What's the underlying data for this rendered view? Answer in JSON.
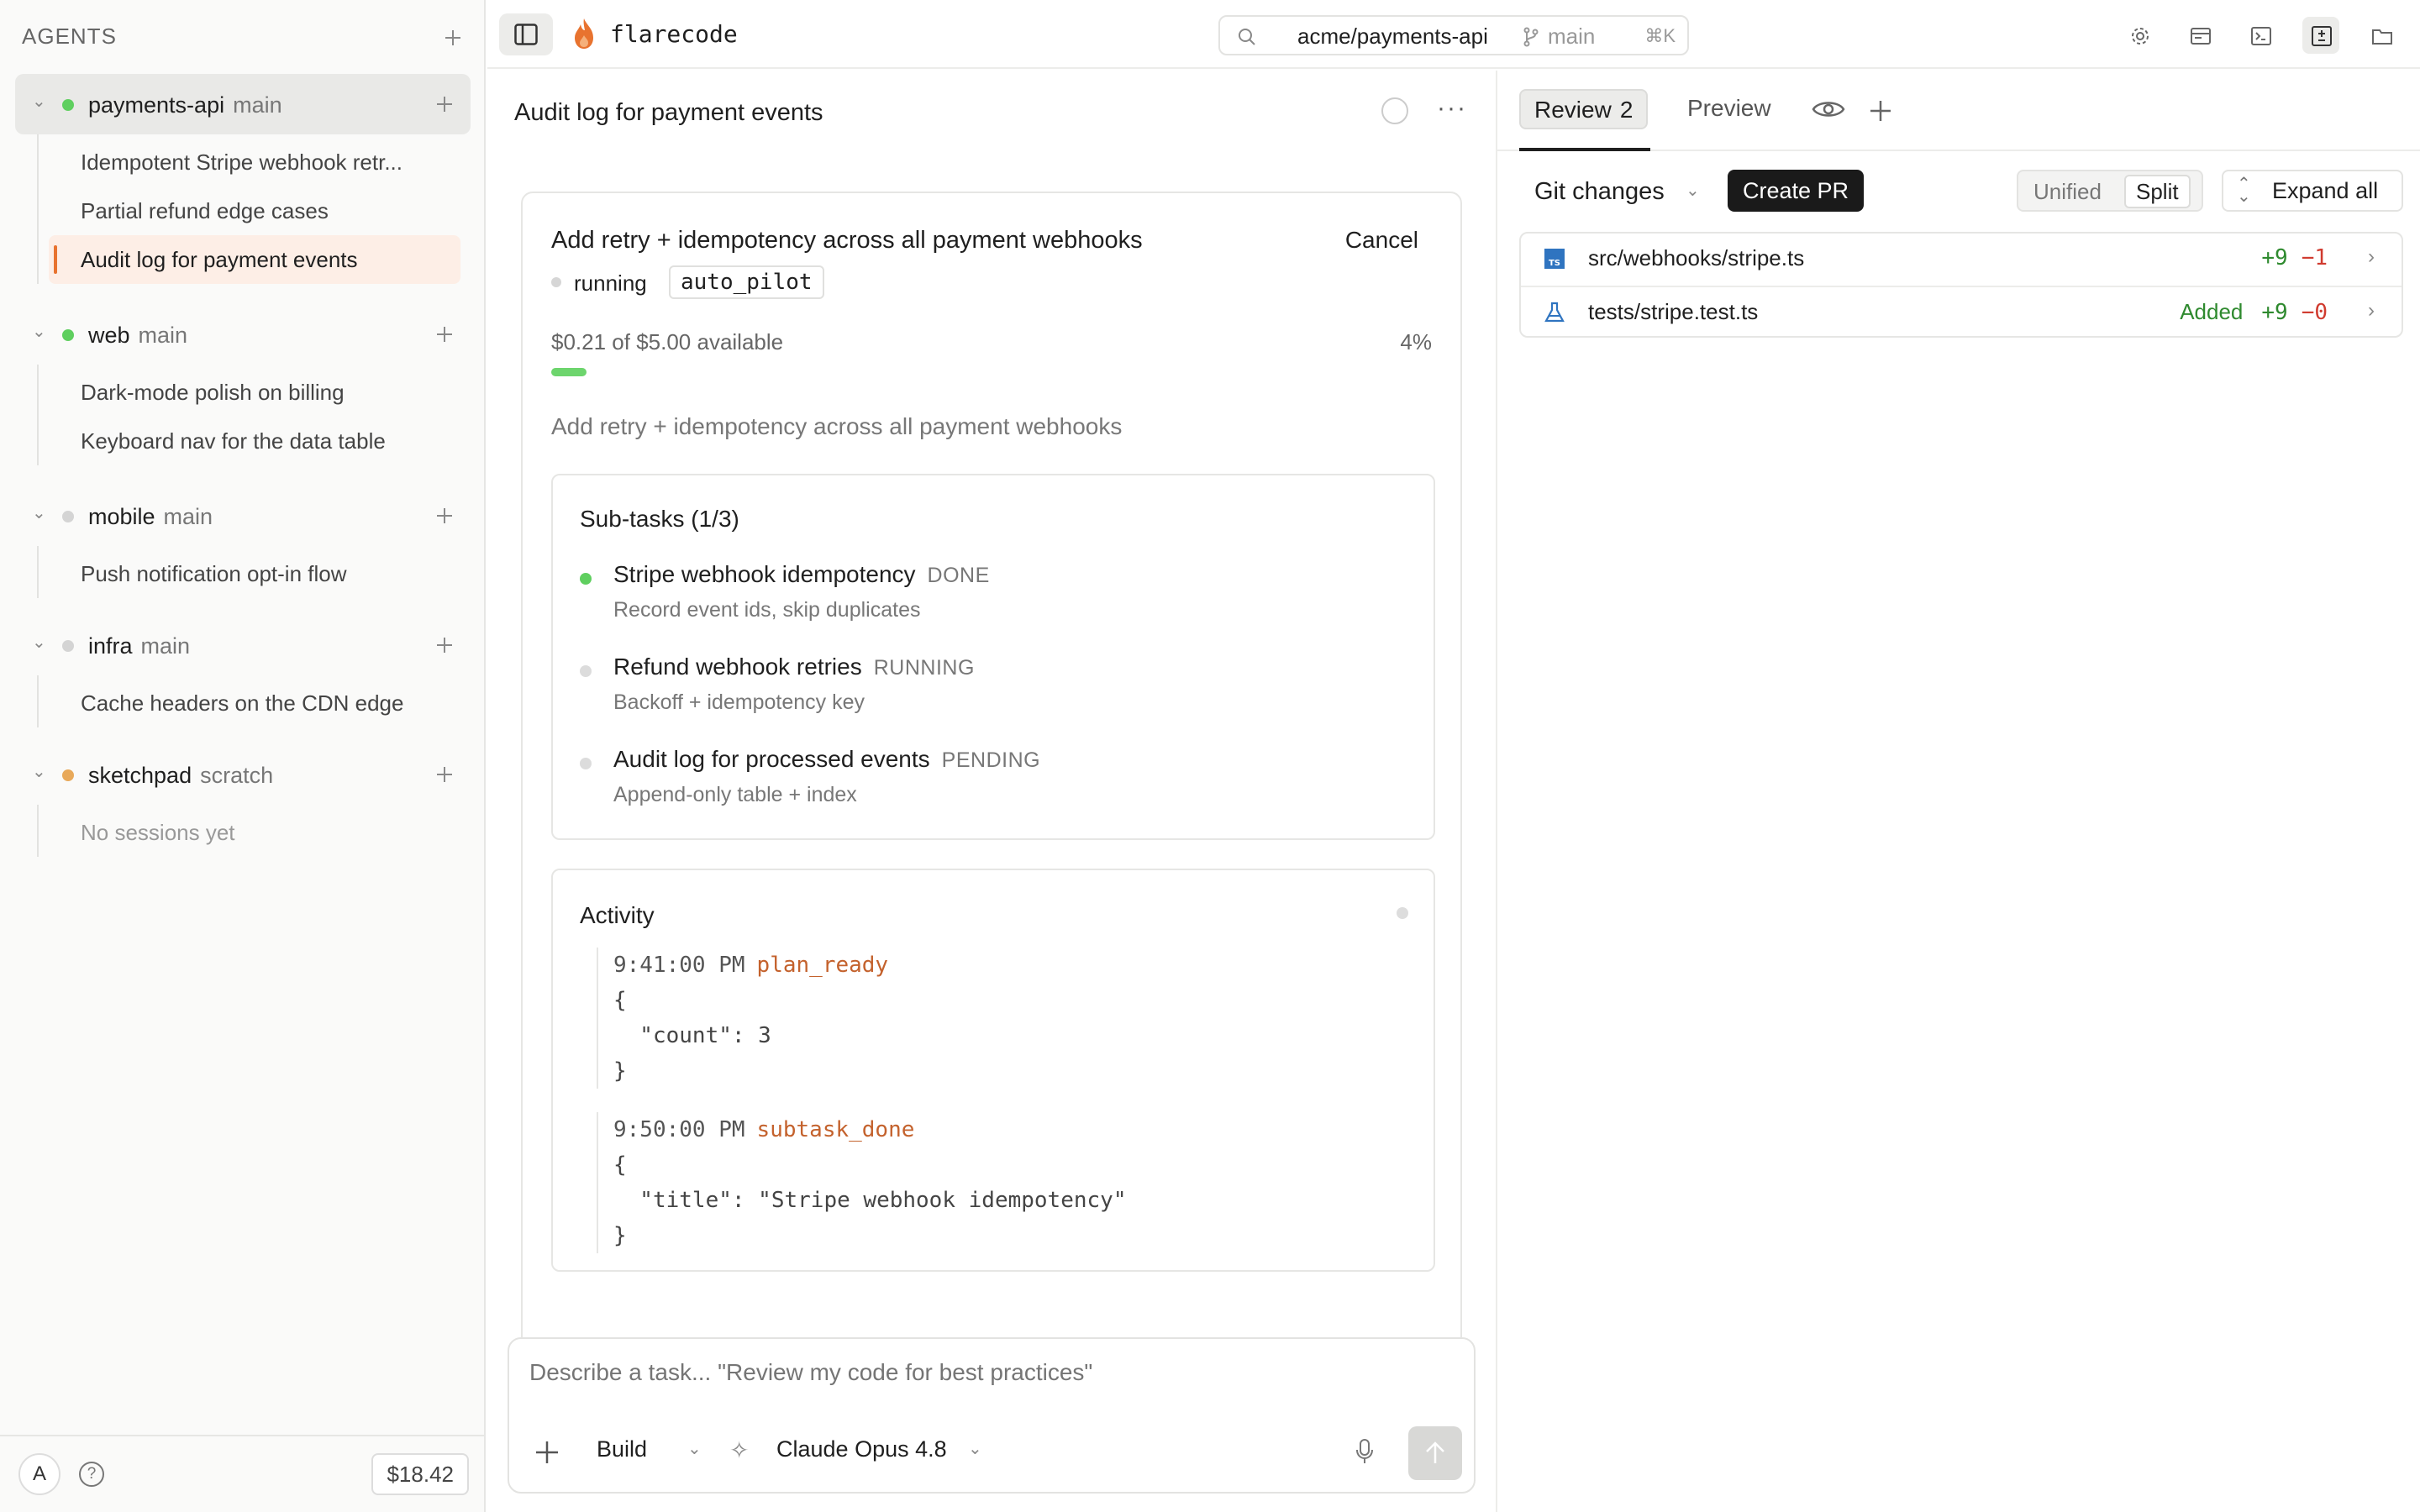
{
  "sidebar": {
    "title": "AGENTS",
    "projects": [
      {
        "name": "payments-api",
        "branch": "main",
        "status_color": "#5fcf5f",
        "sessions": [
          "Idempotent Stripe webhook retr...",
          "Partial refund edge cases",
          "Audit log for payment events"
        ]
      },
      {
        "name": "web",
        "branch": "main",
        "status_color": "#5fcf5f",
        "sessions": [
          "Dark-mode polish on billing",
          "Keyboard nav for the data table"
        ]
      },
      {
        "name": "mobile",
        "branch": "main",
        "status_color": "#d4d4d4",
        "sessions": [
          "Push notification opt-in flow"
        ]
      },
      {
        "name": "infra",
        "branch": "main",
        "status_color": "#d4d4d4",
        "sessions": [
          "Cache headers on the CDN edge"
        ]
      },
      {
        "name": "sketchpad",
        "branch": "scratch",
        "status_color": "#e8a95a",
        "sessions": [
          "No sessions yet"
        ]
      }
    ],
    "footer": {
      "avatar": "A",
      "help": "?",
      "cost": "$18.42"
    }
  },
  "topbar": {
    "brand": "flarecode",
    "repo": "acme/payments-api",
    "branch": "main",
    "shortcut": "⌘K",
    "accent": "#e8732f"
  },
  "session": {
    "title": "Audit log for payment events",
    "more": "···"
  },
  "task": {
    "title": "Add retry + idempotency across all payment webhooks",
    "cancel_label": "Cancel",
    "status": "running",
    "mode_chip": "auto_pilot",
    "budget_text": "$0.21 of $5.00 available",
    "budget_pct_label": "4%",
    "budget_fraction": 0.04,
    "description": "Add retry + idempotency across all payment webhooks",
    "subtasks_header": "Sub-tasks (1/3)",
    "subtasks": [
      {
        "name": "Stripe webhook idempotency",
        "state": "DONE",
        "desc": "Record event ids, skip duplicates",
        "color": "#5fcf5f"
      },
      {
        "name": "Refund webhook retries",
        "state": "RUNNING",
        "desc": "Backoff + idempotency key",
        "color": "#dcdcdc"
      },
      {
        "name": "Audit log for processed events",
        "state": "PENDING",
        "desc": "Append-only table + index",
        "color": "#dcdcdc"
      }
    ],
    "activity_header": "Activity",
    "events": [
      {
        "time": "9:41:00 PM",
        "type": "plan_ready",
        "payload": "{\n  \"count\": 3\n}"
      },
      {
        "time": "9:50:00 PM",
        "type": "subtask_done",
        "payload": "{\n  \"title\": \"Stripe webhook idempotency\"\n}"
      }
    ]
  },
  "composer": {
    "placeholder": "Describe a task... \"Review my code for best practices\"",
    "mode": "Build",
    "model": "Claude Opus 4.8"
  },
  "review": {
    "tabs": [
      {
        "label": "Review",
        "count": "2"
      },
      {
        "label": "Preview"
      }
    ],
    "git_label": "Git changes",
    "create_pr": "Create PR",
    "view_options": [
      "Unified",
      "Split"
    ],
    "view_selected": "Split",
    "expand_all": "Expand all",
    "files": [
      {
        "path": "src/webhooks/stripe.ts",
        "icon": "typescript-file-icon",
        "status": "",
        "additions": "+9",
        "deletions": "−1"
      },
      {
        "path": "tests/stripe.test.ts",
        "icon": "flask-icon",
        "status": "Added",
        "additions": "+9",
        "deletions": "−0"
      }
    ]
  }
}
